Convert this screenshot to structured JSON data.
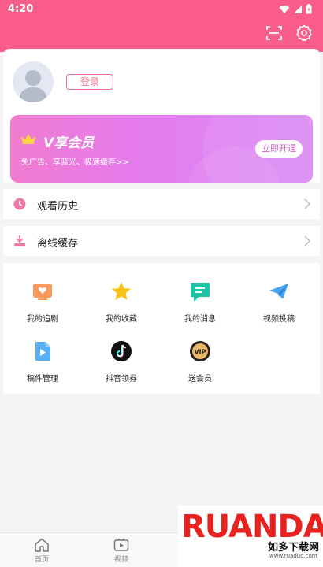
{
  "status": {
    "time": "4:20"
  },
  "header": {
    "scan_icon": "scan-icon",
    "settings_icon": "gear-icon",
    "color": "#fa5d8c"
  },
  "profile": {
    "login_label": "登录",
    "avatar_icon": "user-avatar-icon"
  },
  "vip": {
    "title": "V享会员",
    "subtitle": "免广告、享蓝光、极速缓存>>",
    "button": "立即开通",
    "icon": "crown-icon"
  },
  "menu": [
    {
      "label": "观看历史",
      "icon": "clock-icon"
    },
    {
      "label": "离线缓存",
      "icon": "download-icon"
    }
  ],
  "grid": [
    {
      "label": "我的追剧",
      "icon": "tv-heart-icon"
    },
    {
      "label": "我的收藏",
      "icon": "star-icon"
    },
    {
      "label": "我的消息",
      "icon": "message-icon"
    },
    {
      "label": "视频投稿",
      "icon": "paper-plane-icon"
    },
    {
      "label": "稿件管理",
      "icon": "video-file-icon"
    },
    {
      "label": "抖音领券",
      "icon": "tiktok-icon"
    },
    {
      "label": "送会员",
      "icon": "vip-badge-icon"
    }
  ],
  "nav": [
    {
      "label": "首页",
      "icon": "home-icon"
    },
    {
      "label": "视频",
      "icon": "video-play-icon"
    }
  ],
  "watermark": {
    "logo": "RUANDAO",
    "name": "如多下载网",
    "url": "www.ruaduo.com"
  }
}
